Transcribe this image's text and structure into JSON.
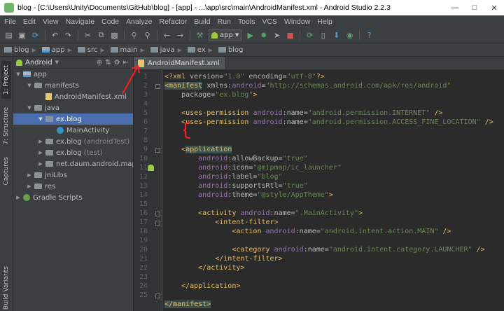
{
  "window": {
    "title": "blog - [C:\\Users\\Unity\\Documents\\GitHub\\blog] - [app] - ...\\app\\src\\main\\AndroidManifest.xml - Android Studio 2.2.3",
    "minimize": "—",
    "maximize": "□",
    "close": "✕"
  },
  "menu": [
    "File",
    "Edit",
    "View",
    "Navigate",
    "Code",
    "Analyze",
    "Refactor",
    "Build",
    "Run",
    "Tools",
    "VCS",
    "Window",
    "Help"
  ],
  "toolbar": {
    "run_config": "app",
    "icons": [
      "open-icon",
      "save-all-icon",
      "sync-icon",
      "undo-icon",
      "redo-icon",
      "cut-icon",
      "copy-icon",
      "paste-icon",
      "find-icon",
      "replace-icon",
      "back-icon",
      "forward-icon",
      "make-icon",
      "run-icon",
      "debug-icon",
      "attach-icon",
      "stop-icon",
      "sync-gradle-icon",
      "avd-icon",
      "sdk-icon",
      "monitor-icon",
      "help-icon"
    ]
  },
  "breadcrumb": [
    "blog",
    "app",
    "src",
    "main",
    "java",
    "ex",
    "blog"
  ],
  "tool_tabs": {
    "project": "1: Project",
    "structure": "7: Structure",
    "captures": "Captures",
    "build_variants": "Build Variants"
  },
  "project_panel": {
    "view_mode": "Android",
    "tree": [
      {
        "label": "app",
        "type": "module"
      },
      {
        "label": "manifests",
        "type": "folder"
      },
      {
        "label": "AndroidManifest.xml",
        "type": "xml"
      },
      {
        "label": "java",
        "type": "folder"
      },
      {
        "label": "ex.blog",
        "type": "package",
        "selected": true
      },
      {
        "label": "MainActivity",
        "type": "class"
      },
      {
        "label": "ex.blog",
        "suffix": "(androidTest)",
        "type": "package"
      },
      {
        "label": "ex.blog",
        "suffix": "(test)",
        "type": "package"
      },
      {
        "label": "net.daum.android.map.ope",
        "type": "package"
      },
      {
        "label": "jniLibs",
        "type": "folder"
      },
      {
        "label": "res",
        "type": "folder"
      },
      {
        "label": "Gradle Scripts",
        "type": "gradle"
      }
    ]
  },
  "editor": {
    "tab": "AndroidManifest.xml",
    "line_numbers": [
      "1",
      "2",
      "3",
      "4",
      "5",
      "6",
      "7",
      "8",
      "9",
      "10",
      "11",
      "12",
      "13",
      "14",
      "15",
      "16",
      "17",
      "18",
      "19",
      "20",
      "21",
      "22",
      "23",
      "24",
      "25"
    ]
  },
  "colors": {
    "tag": "#e8bf6a",
    "namespace": "#9876aa",
    "value": "#6a8759",
    "annotation": "#ff1f1f",
    "selection": "#4b6eaf"
  }
}
